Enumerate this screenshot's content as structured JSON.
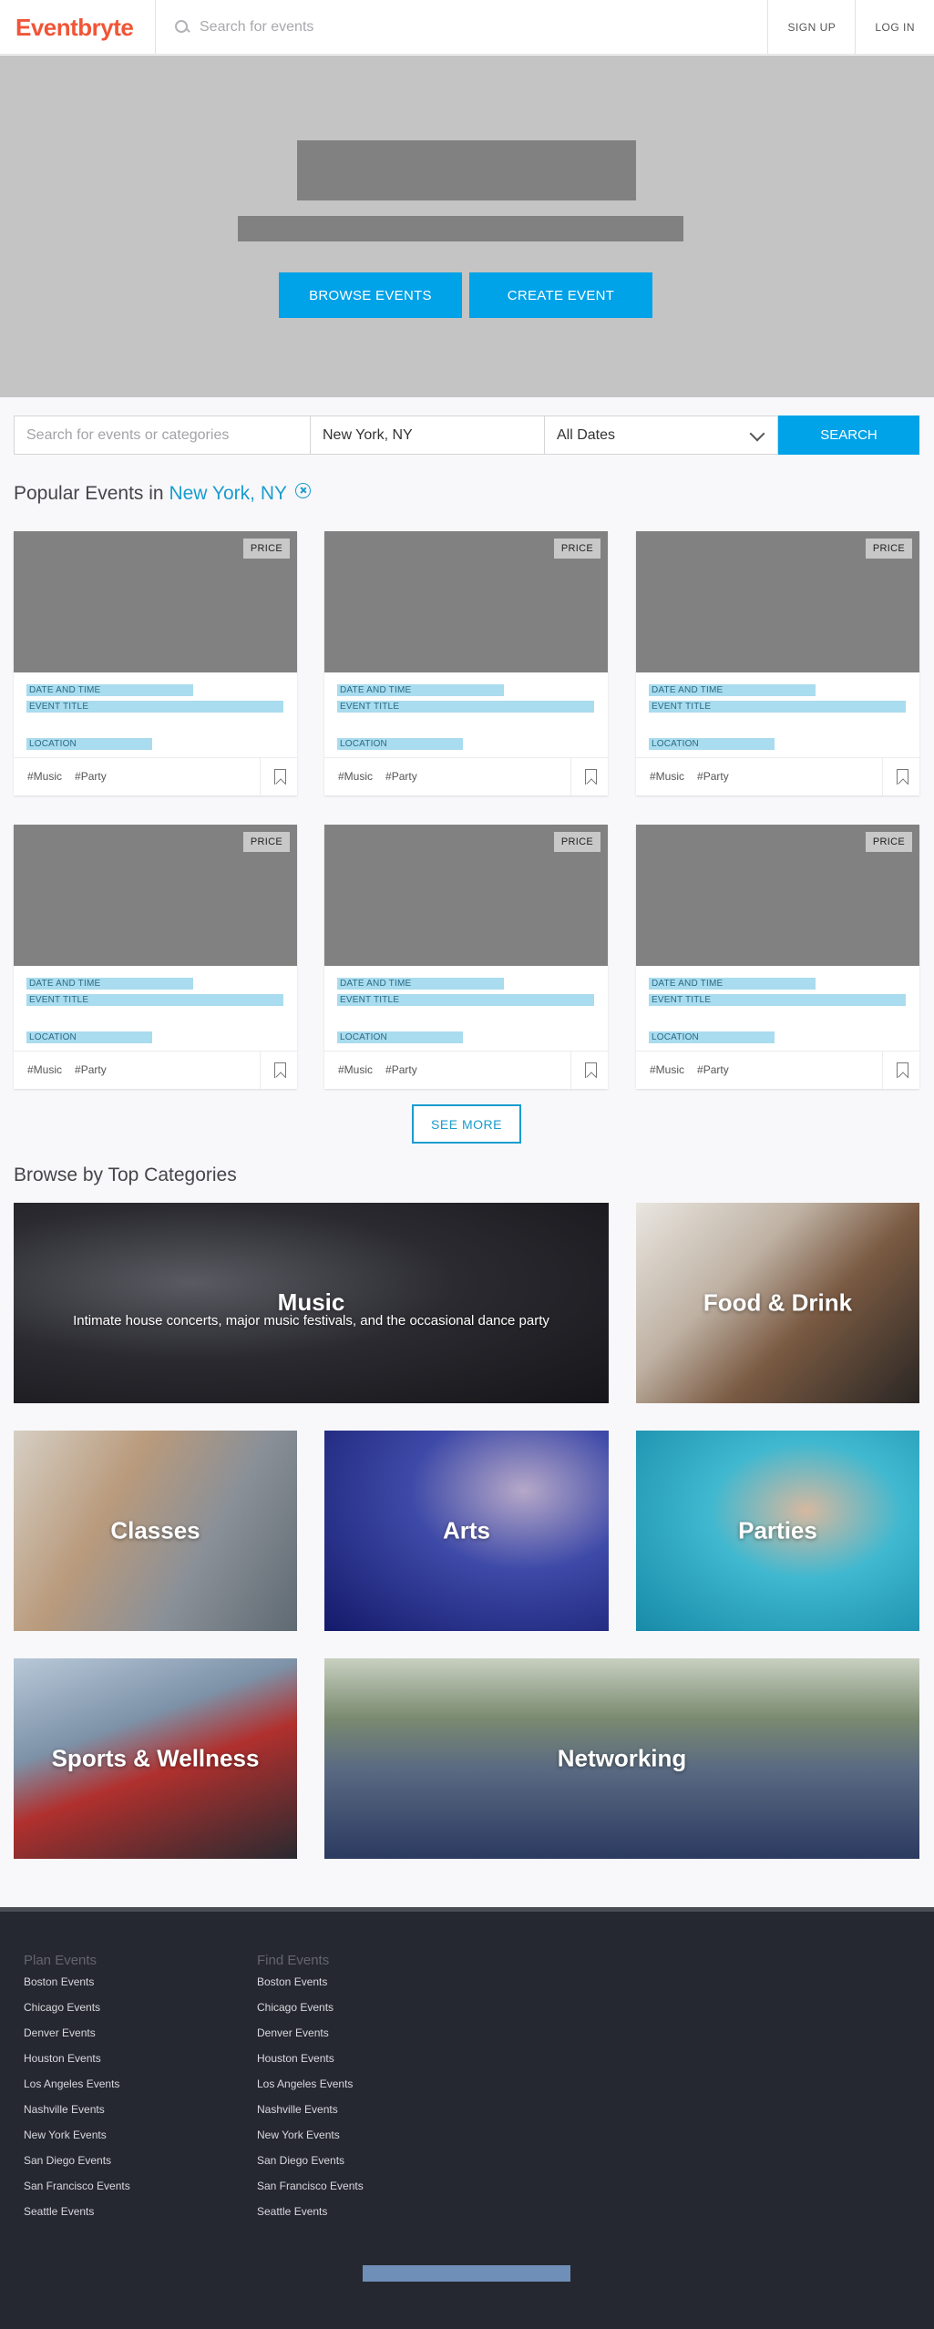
{
  "header": {
    "logo": "Eventbryte",
    "search_placeholder": "Search for events",
    "signup": "SIGN UP",
    "login": "LOG IN"
  },
  "hero": {
    "browse_button": "BROWSE EVENTS",
    "create_button": "CREATE EVENT"
  },
  "search": {
    "query_placeholder": "Search for events or categories",
    "location_value": "New York, NY",
    "date_value": "All Dates",
    "submit_label": "SEARCH"
  },
  "popular": {
    "heading_prefix": "Popular Events in ",
    "city": "New York, NY"
  },
  "event_card": {
    "price_label": "PRICE",
    "date_label": "DATE AND TIME",
    "title_label": "EVENT TITLE",
    "location_label": "LOCATION",
    "tags": [
      "#Music",
      "#Party"
    ]
  },
  "see_more": "SEE MORE",
  "categories": {
    "heading": "Browse by Top Categories",
    "music": {
      "title": "Music",
      "description": "Intimate house concerts, major music festivals, and the occasional dance party"
    },
    "food": {
      "title": "Food & Drink"
    },
    "classes": {
      "title": "Classes"
    },
    "arts": {
      "title": "Arts"
    },
    "parties": {
      "title": "Parties"
    },
    "sports": {
      "title": "Sports & Wellness"
    },
    "networking": {
      "title": "Networking"
    }
  },
  "footer": {
    "plan": {
      "heading": "Plan Events",
      "links": [
        "Boston Events",
        "Chicago Events",
        "Denver Events",
        "Houston Events",
        "Los Angeles Events",
        "Nashville Events",
        "New York Events",
        "San Diego Events",
        "San Francisco Events",
        "Seattle Events"
      ]
    },
    "find": {
      "heading": "Find Events",
      "links": [
        "Boston Events",
        "Chicago Events",
        "Denver Events",
        "Houston Events",
        "Los Angeles Events",
        "Nashville Events",
        "New York Events",
        "San Diego Events",
        "San Francisco Events",
        "Seattle Events"
      ]
    }
  },
  "colors": {
    "brand": "#f05537",
    "accent": "#00a2e8",
    "link": "#1a9ccf",
    "footer_bg": "#262831"
  }
}
